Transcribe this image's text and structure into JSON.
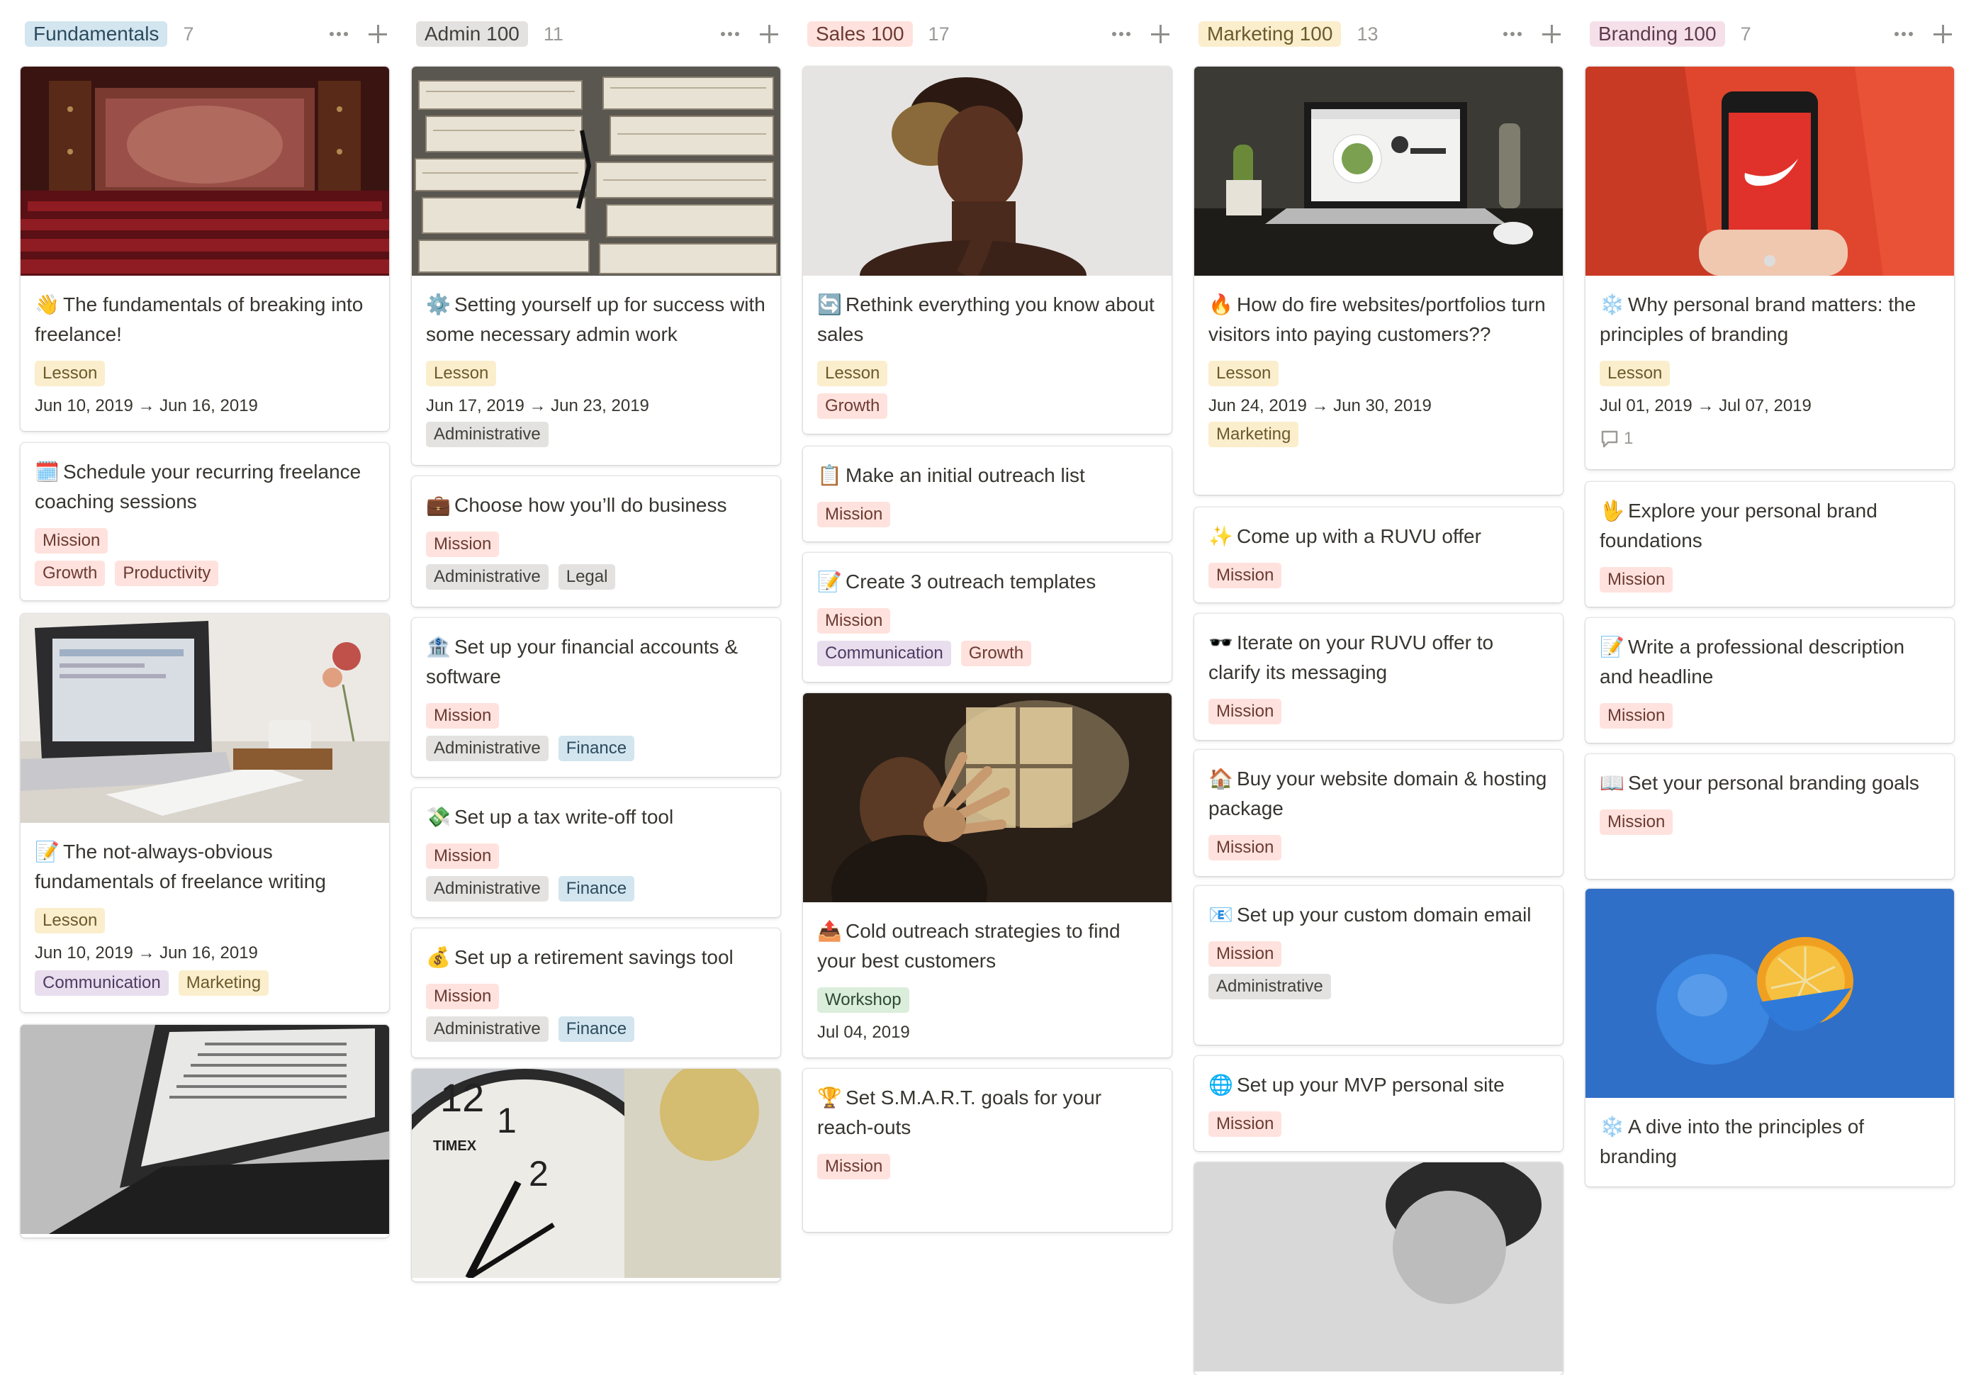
{
  "columns": [
    {
      "title": "Fundamentals",
      "count": "7",
      "title_bg": "#d3e5ef",
      "cards": [
        {
          "emoji": "👋",
          "title": "The fundamentals of breaking into freelance!",
          "cover": "theater",
          "tags": [
            [
              "Lesson"
            ]
          ],
          "date": "Jun 10, 2019 → Jun 16, 2019"
        },
        {
          "emoji": "🗓️",
          "title": "Schedule your recurring freelance coaching sessions",
          "tags": [
            [
              "Mission"
            ],
            [
              "Growth",
              "Productivity"
            ]
          ]
        },
        {
          "emoji": "📝",
          "title": "The not-always-obvious fundamentals of freelance writing",
          "cover": "laptop-desk",
          "tags": [
            [
              "Lesson"
            ]
          ],
          "date": "Jun 10, 2019 → Jun 16, 2019",
          "tags_after": [
            [
              "Communication",
              "Marketing"
            ]
          ]
        },
        {
          "cover": "laptop-text"
        }
      ]
    },
    {
      "title": "Admin 100",
      "count": "11",
      "title_bg": "#e3e2e0",
      "cards": [
        {
          "emoji": "⚙️",
          "title": "Setting yourself up for success with some necessary admin work",
          "cover": "papers",
          "tags": [
            [
              "Lesson"
            ]
          ],
          "date": "Jun 17, 2019 → Jun 23, 2019",
          "tags_after": [
            [
              "Administrative"
            ]
          ]
        },
        {
          "emoji": "💼",
          "title": "Choose how you’ll do business",
          "tags": [
            [
              "Mission"
            ],
            [
              "Administrative",
              "Legal"
            ]
          ]
        },
        {
          "emoji": "🏦",
          "title": "Set up your financial accounts & software",
          "tags": [
            [
              "Mission"
            ],
            [
              "Administrative",
              "Finance"
            ]
          ]
        },
        {
          "emoji": "💸",
          "title": "Set up a tax write-off tool",
          "tags": [
            [
              "Mission"
            ],
            [
              "Administrative",
              "Finance"
            ]
          ]
        },
        {
          "emoji": "💰",
          "title": "Set up a retirement savings tool",
          "tags": [
            [
              "Mission"
            ],
            [
              "Administrative",
              "Finance"
            ]
          ]
        },
        {
          "cover": "clock"
        }
      ]
    },
    {
      "title": "Sales 100",
      "count": "17",
      "title_bg": "#ffe2dd",
      "cards": [
        {
          "emoji": "🔄",
          "title": "Rethink everything you know about sales",
          "cover": "thinker",
          "tags": [
            [
              "Lesson"
            ],
            [
              "Growth"
            ]
          ]
        },
        {
          "emoji": "📋",
          "title": "Make an initial outreach list",
          "tags": [
            [
              "Mission"
            ]
          ]
        },
        {
          "emoji": "📝",
          "title": "Create 3 outreach templates",
          "tags": [
            [
              "Mission"
            ],
            [
              "Communication",
              "Growth"
            ]
          ]
        },
        {
          "emoji": "📤",
          "title": "Cold outreach strategies to find your best customers",
          "cover": "hand",
          "tags": [
            [
              "Workshop"
            ]
          ],
          "date": "Jul 04, 2019"
        },
        {
          "emoji": "🏆",
          "title": "Set S.M.A.R.T. goals for your reach-outs",
          "tags": [
            [
              "Mission"
            ]
          ]
        }
      ]
    },
    {
      "title": "Marketing 100",
      "count": "13",
      "title_bg": "#fbeecc",
      "cards": [
        {
          "emoji": "🔥",
          "title": "How do fire websites/portfolios turn visitors into paying customers??",
          "cover": "laptop-food",
          "tags": [
            [
              "Lesson"
            ]
          ],
          "date": "Jun 24, 2019 → Jun 30, 2019",
          "tags_after": [
            [
              "Marketing"
            ]
          ]
        },
        {
          "emoji": "✨",
          "title": "Come up with a RUVU offer",
          "tags": [
            [
              "Mission"
            ]
          ]
        },
        {
          "emoji": "🕶️",
          "title": "Iterate on your RUVU offer to clarify its messaging",
          "tags": [
            [
              "Mission"
            ]
          ]
        },
        {
          "emoji": "🏠",
          "title": "Buy your website domain & hosting package",
          "tags": [
            [
              "Mission"
            ]
          ]
        },
        {
          "emoji": "📧",
          "title": "Set up your custom domain email",
          "tags": [
            [
              "Mission"
            ],
            [
              "Administrative"
            ]
          ]
        },
        {
          "emoji": "🌐",
          "title": "Set up your MVP personal site",
          "tags": [
            [
              "Mission"
            ]
          ]
        },
        {
          "cover": "portrait"
        }
      ]
    },
    {
      "title": "Branding 100",
      "count": "7",
      "title_bg": "#f5e0e9",
      "cards": [
        {
          "emoji": "❄️",
          "title": "Why personal brand matters: the principles of branding",
          "cover": "phone",
          "tags": [
            [
              "Lesson"
            ]
          ],
          "date": "Jul 01, 2019 → Jul 07, 2019",
          "comments": "1"
        },
        {
          "emoji": "🖖",
          "title": "Explore your personal brand foundations",
          "tags": [
            [
              "Mission"
            ]
          ]
        },
        {
          "emoji": "📝",
          "title": "Write a professional description and headline",
          "tags": [
            [
              "Mission"
            ]
          ]
        },
        {
          "emoji": "📖",
          "title": "Set your personal branding goals",
          "tags": [
            [
              "Mission"
            ]
          ]
        },
        {
          "emoji": "❄️",
          "title": "A dive into the principles of branding",
          "cover": "orange"
        }
      ]
    }
  ],
  "tag_colors": {
    "Lesson": "#fbeecc",
    "Mission": "#ffe2dd",
    "Growth": "#ffe2dd",
    "Productivity": "#ffe2dd",
    "Administrative": "#e3e2e0",
    "Legal": "#e3e2e0",
    "Finance": "#d3e5ef",
    "Communication": "#e8deee",
    "Marketing": "#fbeecc",
    "Workshop": "#dbeddb"
  }
}
